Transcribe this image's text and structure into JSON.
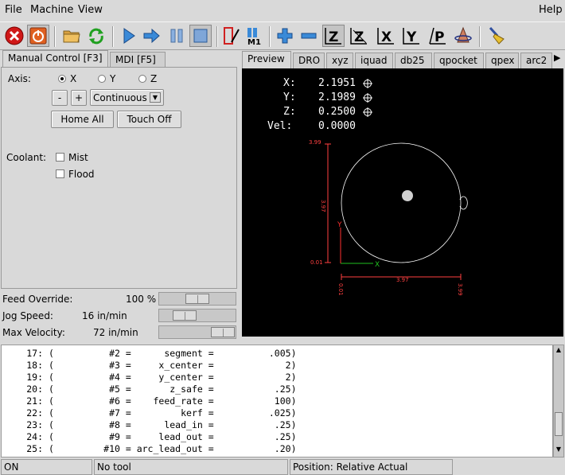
{
  "menubar": {
    "file": "File",
    "machine": "Machine",
    "view": "View",
    "help": "Help"
  },
  "toolbar": {
    "buttons": [
      "estop-icon",
      "power-icon",
      "open-file-icon",
      "reload-icon",
      "run-icon",
      "step-icon",
      "pause-icon",
      "stop-icon",
      "block-delete-icon",
      "optional-stop-icon",
      "zoom-in-icon",
      "zoom-out-icon",
      "view-z-icon",
      "view-z2-icon",
      "view-x-icon",
      "view-y-icon",
      "view-p-icon",
      "rotate-view-icon",
      "clear-plot-icon"
    ],
    "view_z": "Z",
    "view_z2": "Z",
    "view_x": "X",
    "view_y": "Y",
    "view_p": "P",
    "optional_stop_label": "M1"
  },
  "left_tabs": [
    "Manual Control [F3]",
    "MDI [F5]"
  ],
  "manual": {
    "axis_label": "Axis:",
    "axes": [
      "X",
      "Y",
      "Z"
    ],
    "selected_axis": "X",
    "jog_minus": "-",
    "jog_plus": "+",
    "jog_mode": "Continuous",
    "home_all": "Home All",
    "touch_off": "Touch Off",
    "coolant_label": "Coolant:",
    "mist": "Mist",
    "flood": "Flood"
  },
  "overrides": {
    "feed_label": "Feed Override:",
    "feed_value": "100 %",
    "feed_fraction": 0.5,
    "jog_label": "Jog Speed:",
    "jog_value": "16 in/min",
    "jog_fraction": 0.25,
    "vel_label": "Max Velocity:",
    "vel_value": "72 in/min",
    "vel_fraction": 1.0
  },
  "right_tabs": [
    "Preview",
    "DRO",
    "xyz",
    "iquad",
    "db25",
    "qpocket",
    "qpex",
    "arc2"
  ],
  "dro": {
    "x_label": "X:",
    "x_value": "2.1951",
    "y_label": "Y:",
    "y_value": "2.1989",
    "z_label": "Z:",
    "z_value": "0.2500",
    "vel_label": "Vel:",
    "vel_value": "0.0000"
  },
  "plot_labels": {
    "top": "3.99",
    "height": "3.97",
    "bottom": "0.01",
    "width": "3.97",
    "xmin": "0.01",
    "xmax": "3.99",
    "axis_x": "X",
    "axis_y": "Y"
  },
  "colors": {
    "extent": "#ff4040",
    "axis_x": "#20c020",
    "axis_y": "#ff3030",
    "path": "#ffffff",
    "background": "#000000"
  },
  "gcode_lines": [
    {
      "n": "17:",
      "text": "(          #2 =      segment =          .005)"
    },
    {
      "n": "18:",
      "text": "(          #3 =     x_center =             2)"
    },
    {
      "n": "19:",
      "text": "(          #4 =     y_center =             2)"
    },
    {
      "n": "20:",
      "text": "(          #5 =       z_safe =           .25)"
    },
    {
      "n": "21:",
      "text": "(          #6 =    feed_rate =           100)"
    },
    {
      "n": "22:",
      "text": "(          #7 =         kerf =          .025)"
    },
    {
      "n": "23:",
      "text": "(          #8 =      lead_in =           .25)"
    },
    {
      "n": "24:",
      "text": "(          #9 =     lead_out =           .25)"
    },
    {
      "n": "25:",
      "text": "(         #10 = arc_lead_out =           .20)"
    }
  ],
  "status": {
    "machine": "ON",
    "tool": "No tool",
    "position": "Position: Relative Actual"
  }
}
